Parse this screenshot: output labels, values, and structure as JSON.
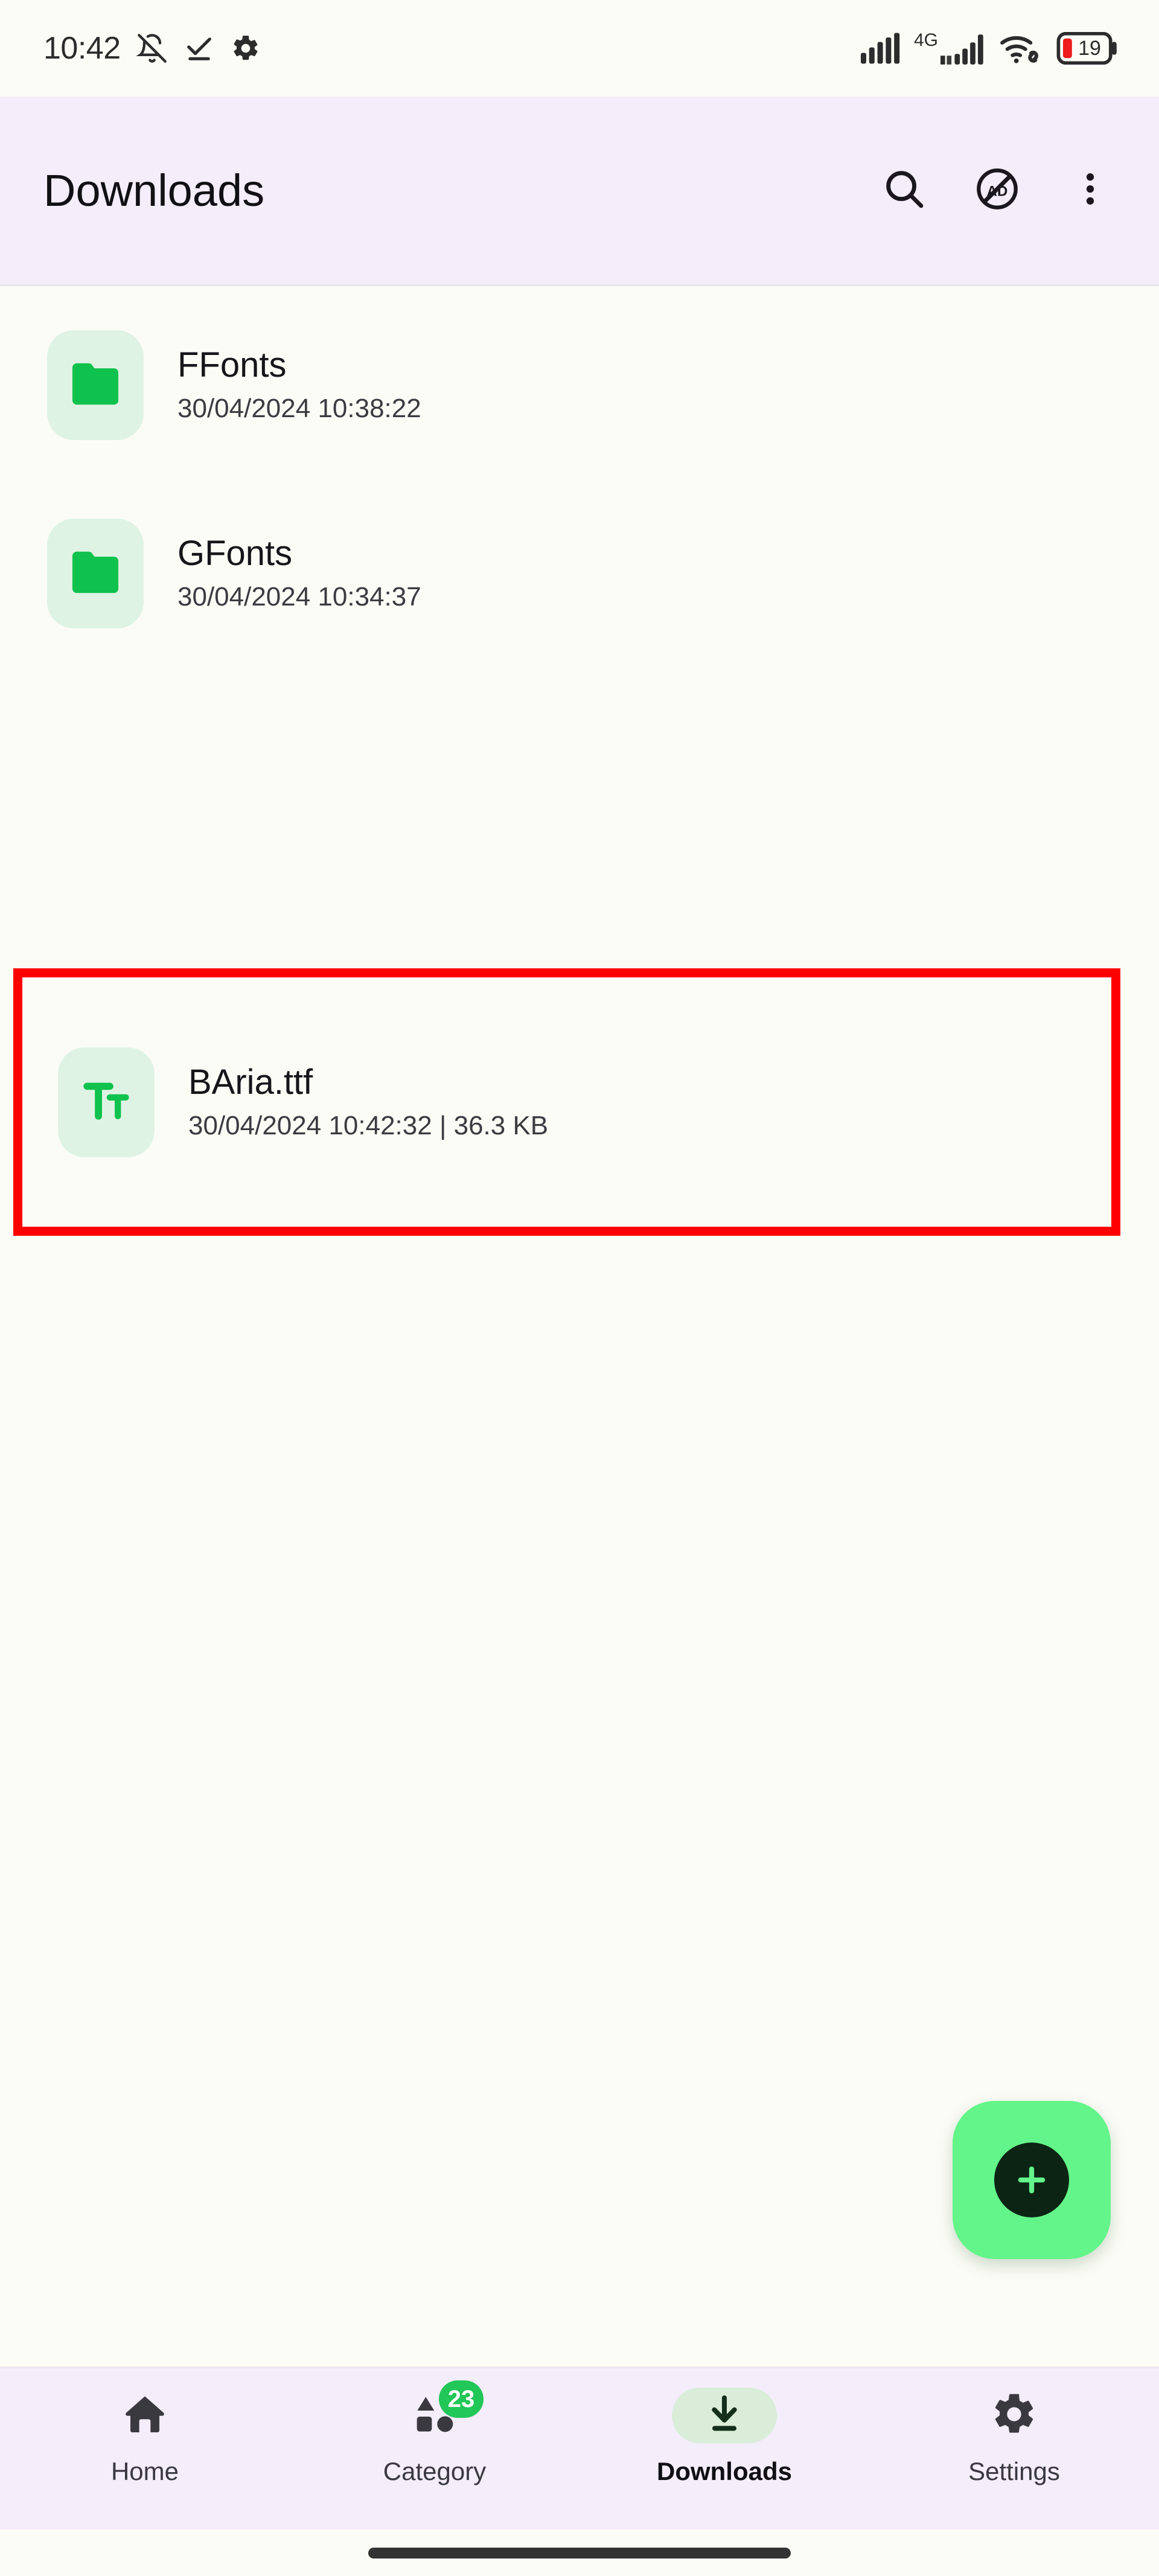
{
  "status_bar": {
    "clock": "10:42",
    "left_icons": [
      "bell-off-icon",
      "download-done-icon",
      "gear-icon"
    ],
    "network_label": "4G",
    "right_icons": [
      "signal-bars-icon",
      "signal-bars-4g-icon",
      "wifi-link-icon",
      "battery-icon"
    ],
    "battery_level": "19"
  },
  "app_bar": {
    "title": "Downloads",
    "actions": [
      {
        "name": "search-icon",
        "label": "Search"
      },
      {
        "name": "no-ads-icon",
        "label": "AD"
      },
      {
        "name": "overflow-menu-icon",
        "label": "More options"
      }
    ]
  },
  "files": [
    {
      "name": "FFonts",
      "subtitle": "30/04/2024 10:38:22",
      "icon": "folder-icon",
      "type": "folder",
      "highlighted": false
    },
    {
      "name": "GFonts",
      "subtitle": "30/04/2024 10:34:37",
      "icon": "folder-icon",
      "type": "folder",
      "highlighted": false
    },
    {
      "name": "BAria.ttf",
      "subtitle": "30/04/2024 10:42:32 | 36.3 KB",
      "icon": "font-file-icon",
      "type": "font",
      "highlighted": true
    }
  ],
  "fab": {
    "icon": "plus-icon",
    "label": "Add"
  },
  "bottom_nav": {
    "items": [
      {
        "label": "Home",
        "icon": "home-icon",
        "active": false,
        "badge": ""
      },
      {
        "label": "Category",
        "icon": "category-shapes-icon",
        "active": false,
        "badge": "23"
      },
      {
        "label": "Downloads",
        "icon": "download-icon",
        "active": true,
        "badge": ""
      },
      {
        "label": "Settings",
        "icon": "settings-gear-icon",
        "active": false,
        "badge": ""
      }
    ]
  },
  "colors": {
    "app_bar_bg": "#F4EDFA",
    "content_bg": "#FCFCF6",
    "accent_green": "#0FC24D",
    "icon_tile_bg": "#DFF3E4",
    "fab_green": "#63F58A",
    "badge_green": "#21C757",
    "highlight_red": "#FF0000",
    "active_pill": "#D9EDD9"
  }
}
